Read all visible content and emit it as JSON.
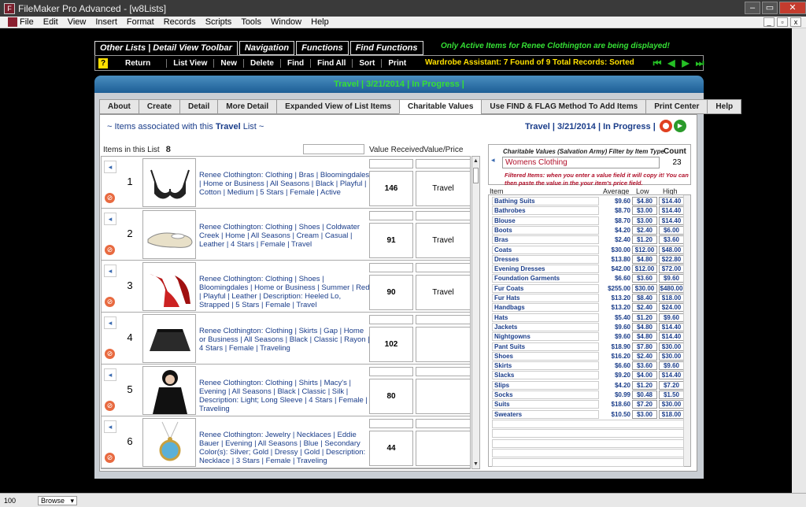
{
  "window": {
    "title": "FileMaker Pro Advanced - [w8Lists]",
    "app_icon": "filemaker-icon"
  },
  "menu": [
    "File",
    "Edit",
    "View",
    "Insert",
    "Format",
    "Records",
    "Scripts",
    "Tools",
    "Window",
    "Help"
  ],
  "toolbar_tabs": [
    "Other Lists | Detail View Toolbar",
    "Navigation",
    "Functions",
    "Find Functions"
  ],
  "active_message": "Only Active Items for Renee Clothington are being displayed!",
  "toolbar_buttons": [
    "Return",
    "List View",
    "New",
    "Delete",
    "Find",
    "Find All",
    "Sort",
    "Print"
  ],
  "help_label": "?",
  "wardrobe_status": "Wardrobe Assistant:  7 Found of 9 Total Records: Sorted",
  "header_title": "Travel | 3/21/2014 | In Progress |",
  "nav_tabs": [
    "About",
    "Create",
    "Detail",
    "More Detail",
    "Expanded View of List Items",
    "Charitable Values",
    "Use FIND & FLAG Method To Add Items",
    "Print Center",
    "Help"
  ],
  "active_nav_tab": "Charitable Values",
  "list_heading": {
    "prefix": "~  Items associated with this ",
    "name": "Travel",
    "suffix": " List  ~"
  },
  "list_status": "Travel | 3/21/2014 | In Progress |",
  "items_in_list_label": "Items in this List",
  "items_in_list_count": "8",
  "col_value_received": "Value Received",
  "col_value_price": "Value/Price",
  "rows": [
    {
      "num": "1",
      "desc": "Renee Clothington: Clothing | Bras | Bloomingdales | Home or Business | All Seasons | Black | Playful | Cotton | Medium | 5 Stars | Female | Active",
      "value_received": "146",
      "value_price": "Travel",
      "icon": "bra-image"
    },
    {
      "num": "2",
      "desc": "Renee Clothington: Clothing | Shoes | Coldwater Creek | Home | All Seasons | Cream | Casual | Leather | 4 Stars | Female | Travel",
      "value_received": "91",
      "value_price": "Travel",
      "icon": "flat-shoe-image"
    },
    {
      "num": "3",
      "desc": "Renee Clothington: Clothing | Shoes | Bloomingdales | Home or Business | Summer | Red | Playful | Leather | Description: Heeled Lo, Strapped | 5 Stars | Female | Travel",
      "value_received": "90",
      "value_price": "Travel",
      "icon": "red-heel-image"
    },
    {
      "num": "4",
      "desc": "Renee Clothington: Clothing | Skirts | Gap | Home or Business | All Seasons | Black | Classic | Rayon | 4 Stars | Female | Traveling",
      "value_received": "102",
      "value_price": "",
      "icon": "skirt-image"
    },
    {
      "num": "5",
      "desc": "Renee Clothington: Clothing | Shirts | Macy's | Evening | All Seasons | Black | Classic | Silk | Description: Light; Long Sleeve | 4 Stars | Female | Traveling",
      "value_received": "80",
      "value_price": "",
      "icon": "shirt-image"
    },
    {
      "num": "6",
      "desc": "Renee Clothington: Jewelry | Necklaces | Eddie Bauer | Evening | All Seasons | Blue | Secondary Color(s): Silver; Gold | Dressy | Gold | Description: Necklace | 3 Stars | Female | Traveling",
      "value_received": "44",
      "value_price": "",
      "icon": "necklace-image"
    }
  ],
  "charitable": {
    "title": "Charitable Values  (Salvation Army) Filter by Item Type",
    "count_label": "Count",
    "filter_value": "Womens Clothing",
    "count_value": "23",
    "note": "Filtered Items: when you enter a value field it will copy it! You can then paste the value in the your item's price field.",
    "col_item": "Item",
    "col_average": "Average",
    "col_low": "Low",
    "col_high": "High",
    "items": [
      {
        "name": "Bathing Suits",
        "avg": "$9.60",
        "low": "$4.80",
        "high": "$14.40"
      },
      {
        "name": "Bathrobes",
        "avg": "$8.70",
        "low": "$3.00",
        "high": "$14.40"
      },
      {
        "name": "Blouse",
        "avg": "$8.70",
        "low": "$3.00",
        "high": "$14.40"
      },
      {
        "name": "Boots",
        "avg": "$4.20",
        "low": "$2.40",
        "high": "$6.00"
      },
      {
        "name": "Bras",
        "avg": "$2.40",
        "low": "$1.20",
        "high": "$3.60"
      },
      {
        "name": "Coats",
        "avg": "$30.00",
        "low": "$12.00",
        "high": "$48.00"
      },
      {
        "name": "Dresses",
        "avg": "$13.80",
        "low": "$4.80",
        "high": "$22.80"
      },
      {
        "name": "Evening Dresses",
        "avg": "$42.00",
        "low": "$12.00",
        "high": "$72.00"
      },
      {
        "name": "Foundation Garments",
        "avg": "$6.60",
        "low": "$3.60",
        "high": "$9.60"
      },
      {
        "name": "Fur Coats",
        "avg": "$255.00",
        "low": "$30.00",
        "high": "$480.00"
      },
      {
        "name": "Fur Hats",
        "avg": "$13.20",
        "low": "$8.40",
        "high": "$18.00"
      },
      {
        "name": "Handbags",
        "avg": "$13.20",
        "low": "$2.40",
        "high": "$24.00"
      },
      {
        "name": "Hats",
        "avg": "$5.40",
        "low": "$1.20",
        "high": "$9.60"
      },
      {
        "name": "Jackets",
        "avg": "$9.60",
        "low": "$4.80",
        "high": "$14.40"
      },
      {
        "name": "Nightgowns",
        "avg": "$9.60",
        "low": "$4.80",
        "high": "$14.40"
      },
      {
        "name": "Pant Suits",
        "avg": "$18.90",
        "low": "$7.80",
        "high": "$30.00"
      },
      {
        "name": "Shoes",
        "avg": "$16.20",
        "low": "$2.40",
        "high": "$30.00"
      },
      {
        "name": "Skirts",
        "avg": "$6.60",
        "low": "$3.60",
        "high": "$9.60"
      },
      {
        "name": "Slacks",
        "avg": "$9.20",
        "low": "$4.00",
        "high": "$14.40"
      },
      {
        "name": "Slips",
        "avg": "$4.20",
        "low": "$1.20",
        "high": "$7.20"
      },
      {
        "name": "Socks",
        "avg": "$0.99",
        "low": "$0.48",
        "high": "$1.50"
      },
      {
        "name": "Suits",
        "avg": "$18.60",
        "low": "$7.20",
        "high": "$30.00"
      },
      {
        "name": "Sweaters",
        "avg": "$10.50",
        "low": "$3.00",
        "high": "$18.00"
      }
    ]
  },
  "status_bar": {
    "zoom": "100",
    "mode": "Browse"
  }
}
